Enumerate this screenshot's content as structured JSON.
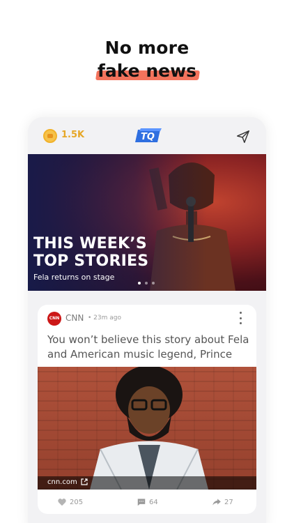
{
  "headline": {
    "line1": "No more",
    "line2": "fake news"
  },
  "topbar": {
    "coins": "1.5K",
    "logo_text": "TQ"
  },
  "hero": {
    "title_line1": "THIS WEEK’S",
    "title_line2": "TOP STORIES",
    "subtitle": "Fela returns on stage",
    "active_dot": 0
  },
  "card": {
    "source_logo": "CNN",
    "source_name": "CNN",
    "time": "• 23m ago",
    "title": "You won’t believe this story about Fela and American music legend, Prince",
    "image_source": "cnn.com",
    "likes": "205",
    "comments": "64",
    "shares": "27"
  },
  "colors": {
    "accent": "#f4735c",
    "coin": "#e6a727",
    "hero_overlay": "#141c50",
    "cnn": "#cc1717"
  },
  "icons": [
    "coin-icon",
    "send-icon",
    "more-icon",
    "external-link-icon",
    "heart-icon",
    "comment-icon",
    "share-icon"
  ]
}
